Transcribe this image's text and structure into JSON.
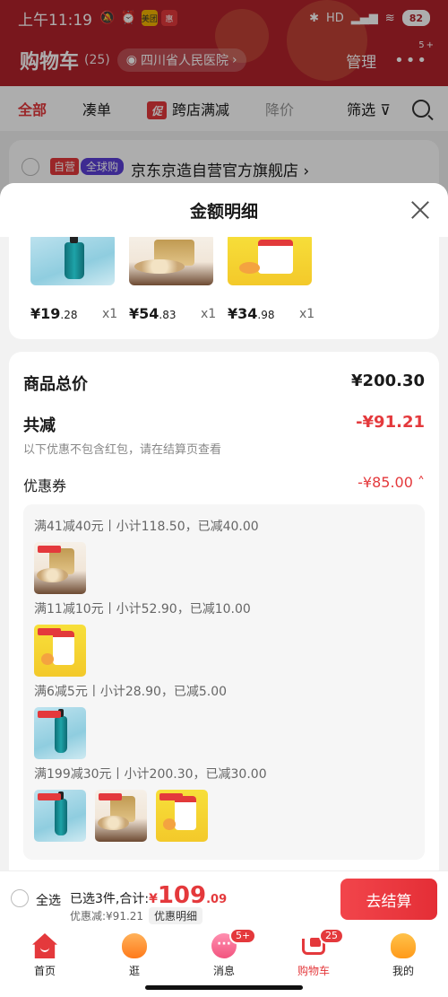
{
  "status_bar": {
    "time": "上午11:19",
    "badge_app1": "美团",
    "badge_app2": "惠",
    "battery": "82",
    "network": "HD"
  },
  "header": {
    "title": "购物车",
    "count": "(25)",
    "location": "四川省人民医院",
    "manage": "管理",
    "more_badge": "5+"
  },
  "filter_bar": {
    "tab_all": "全部",
    "tab_bundle": "凑单",
    "promo_tag": "促",
    "tab_cross_store": "跨店满减",
    "tab_price_drop": "降价",
    "filter": "筛选"
  },
  "store": {
    "tag_self": "自营",
    "tag_global": "全球购",
    "name": "京东京造自营官方旗舰店 ›"
  },
  "sheet": {
    "title": "金额明细",
    "products": [
      {
        "currency": "¥",
        "int": "19",
        "dec": ".28",
        "qty": "x1"
      },
      {
        "currency": "¥",
        "int": "54",
        "dec": ".83",
        "qty": "x1"
      },
      {
        "currency": "¥",
        "int": "34",
        "dec": ".98",
        "qty": "x1"
      }
    ],
    "total_label": "商品总价",
    "total_value": "¥200.30",
    "reduce_label": "共减",
    "reduce_value": "-¥91.21",
    "reduce_note": "以下优惠不包含红包，请在结算页查看",
    "coupon_label": "优惠券",
    "coupon_value": "-¥85.00 ˄",
    "coupon_groups": [
      {
        "rule": "满41减40元丨小计118.50，已减40.00"
      },
      {
        "rule": "满11减10元丨小计52.90，已减10.00"
      },
      {
        "rule": "满6减5元丨小计28.90，已减5.00"
      },
      {
        "rule": "满199减30元丨小计200.30，已减30.00"
      }
    ]
  },
  "settle_bar": {
    "select_all": "全选",
    "selected_text": "已选3件,合计:",
    "currency": "¥",
    "amount_int": "109",
    "amount_dec": ".09",
    "discount_text": "优惠减:¥91.21",
    "detail_pill": "优惠明细",
    "checkout": "去结算"
  },
  "tab_bar": {
    "home": "首页",
    "browse": "逛",
    "messages": "消息",
    "messages_badge": "5+",
    "cart": "购物车",
    "cart_badge": "25",
    "me": "我的"
  },
  "colors": {
    "accent_red": "#e4393c",
    "header_red": "#b3232b",
    "global_purple": "#5b3fd6"
  }
}
